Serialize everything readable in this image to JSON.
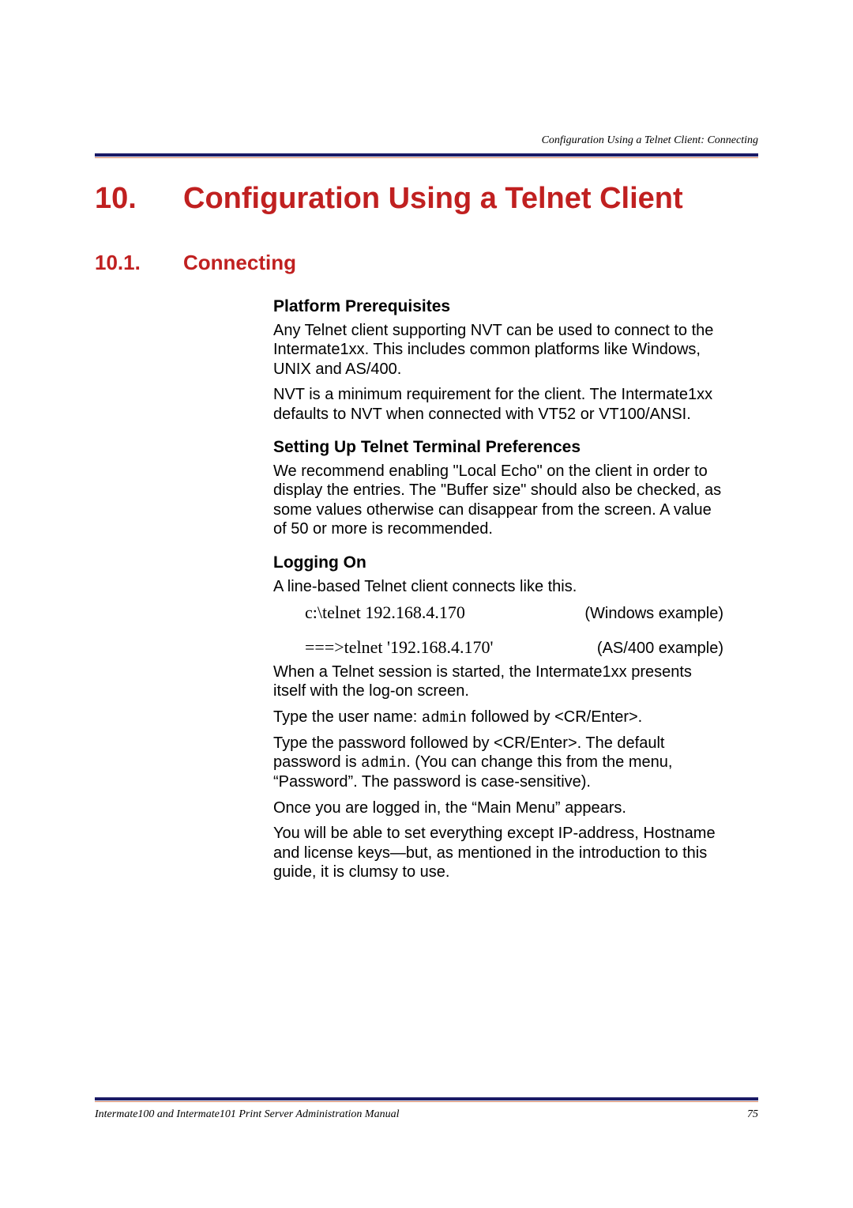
{
  "runningHeader": "Configuration Using a Telnet Client: Connecting",
  "chapter": {
    "num": "10.",
    "title": "Configuration Using a Telnet Client"
  },
  "section": {
    "num": "10.1.",
    "title": "Connecting"
  },
  "sub1": {
    "heading": "Platform Prerequisites",
    "p1": "Any Telnet client supporting NVT can be used to connect to the Intermate1xx. This includes common platforms like Windows, UNIX and AS/400.",
    "p2": "NVT is a minimum requirement for the client. The Intermate1xx defaults to NVT when connected with VT52 or VT100/ANSI."
  },
  "sub2": {
    "heading": "Setting Up Telnet Terminal Preferences",
    "p1": "We recommend enabling \"Local Echo\" on the client in order to display the entries. The \"Buffer size\" should also be checked, as some values otherwise can disappear from the screen. A value of 50 or more is recommended."
  },
  "sub3": {
    "heading": "Logging On",
    "p1": "A line-based Telnet client connects like this.",
    "ex1cmd": "c:\\telnet 192.168.4.170",
    "ex1note": "(Windows example)",
    "ex2cmd": "===>telnet '192.168.4.170'",
    "ex2note": "(AS/400 example)",
    "p2": "When a Telnet session is started, the Intermate1xx presents itself with the log-on screen.",
    "p3a": "Type the user name: ",
    "p3code": "admin",
    "p3b": " followed by <CR/Enter>.",
    "p4a": "Type the password followed by <CR/Enter>. The default password is ",
    "p4code": "admin",
    "p4b": ". (You can change this from the menu, “Password”. The password is case-sensitive).",
    "p5": "Once you are logged in, the “Main Menu” appears.",
    "p6": "You will be able to set everything except IP-address, Hostname and license keys—but, as mentioned in the introduction to this guide, it is clumsy to use."
  },
  "footer": {
    "left": "Intermate100 and Intermate101 Print Server Administration Manual",
    "right": "75"
  }
}
